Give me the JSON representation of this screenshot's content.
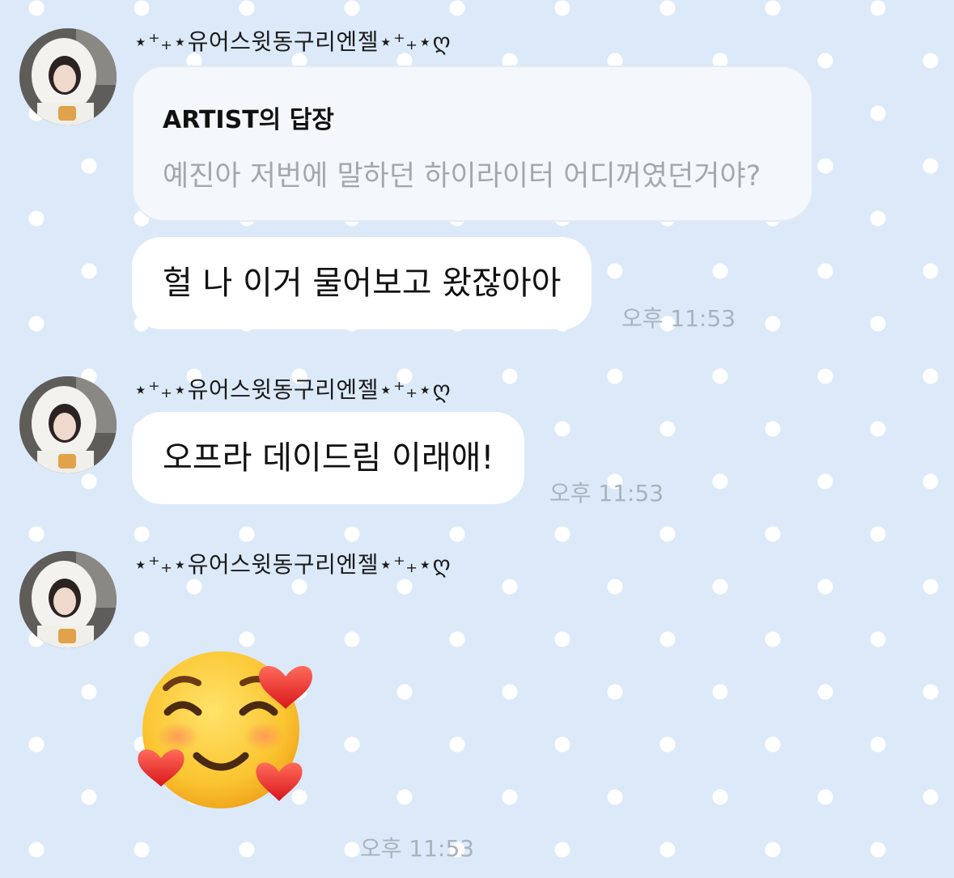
{
  "chat": {
    "sender_name": "⋆⁺₊⋆유어스윗동구리엔젤⋆⁺₊⋆ღ",
    "messages": [
      {
        "reply": {
          "title": "ARTIST의 답장",
          "body": "예진아 저번에 말하던 하이라이터 어디꺼였던거야?"
        },
        "text": "헐 나 이거 물어보고 왔잖아아",
        "time": "오후 11:53"
      },
      {
        "text": "오프라 데이드림 이래애!",
        "time": "오후 11:53"
      },
      {
        "emoji": "smiling-face-with-hearts",
        "time": "오후 11:53"
      }
    ]
  },
  "colors": {
    "background": "#dce9f9",
    "bubble": "#ffffff",
    "reply_card": "#f4f8fd",
    "time_text": "#a9b2bd"
  }
}
